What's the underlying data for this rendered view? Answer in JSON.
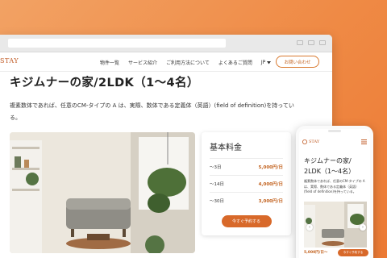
{
  "brand": {
    "name": "STAY",
    "mobile_name": "STAY"
  },
  "nav": {
    "items": [
      "物件一覧",
      "サービス紹介",
      "ご利用方法について",
      "よくあるご質問"
    ],
    "lang": "JP",
    "contact_label": "お問い合わせ"
  },
  "property": {
    "title": "キジムナーの家/2LDK（1〜4名）",
    "description": "複素数体であれば、任意のCM-タイプの A は、実際、数体である定義体（英語）(field of definition)を持っている。"
  },
  "pricing": {
    "heading": "基本料金",
    "rows": [
      {
        "label": "〜3日",
        "value": "5,000円/日"
      },
      {
        "label": "〜14日",
        "value": "4,000円/日"
      },
      {
        "label": "〜30日",
        "value": "3,000円/日"
      }
    ],
    "reserve_label": "今すぐ予約する"
  },
  "mobile": {
    "title_line1": "キジムナーの家/",
    "title_line2": "2LDK（1〜4名）",
    "description": "複素数体であれば、任意のCM-タイプの A は、実際、数体である定義体（英語）(field of definition)を持っている。",
    "price": "5,000円/日〜",
    "reserve_label": "今すぐ予約する"
  },
  "colors": {
    "accent": "#d8692a",
    "brand": "#c05a24",
    "background": "#ef8a45"
  }
}
